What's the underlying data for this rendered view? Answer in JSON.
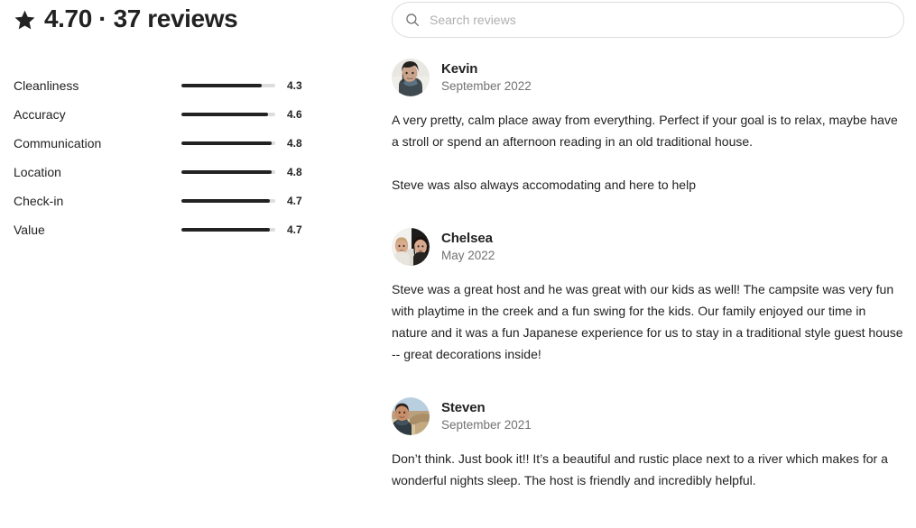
{
  "summary": {
    "star_icon": "star-icon",
    "headline": "4.70 · 37 reviews",
    "rating": "4.70",
    "review_count": "37 reviews"
  },
  "categories": [
    {
      "label": "Cleanliness",
      "value": "4.3",
      "fill_pct": 86
    },
    {
      "label": "Accuracy",
      "value": "4.6",
      "fill_pct": 92
    },
    {
      "label": "Communication",
      "value": "4.8",
      "fill_pct": 96
    },
    {
      "label": "Location",
      "value": "4.8",
      "fill_pct": 96
    },
    {
      "label": "Check-in",
      "value": "4.7",
      "fill_pct": 94
    },
    {
      "label": "Value",
      "value": "4.7",
      "fill_pct": 94
    }
  ],
  "search": {
    "icon": "search-icon",
    "placeholder": "Search reviews",
    "value": ""
  },
  "reviews": [
    {
      "avatar_alt": "avatar",
      "name": "Kevin",
      "date": "September 2022",
      "text": "A very pretty, calm place away from everything. Perfect if your goal is to relax, maybe have a stroll or spend an afternoon reading in an old traditional house.\n\nSteve was also always accomodating and here to help"
    },
    {
      "avatar_alt": "avatar",
      "name": "Chelsea",
      "date": "May 2022",
      "text": "Steve was a great host and he was great with our kids as well! The campsite was very fun with playtime in the creek and a fun swing for the kids. Our family enjoyed our time in nature and it was a fun Japanese experience for us to stay in a traditional style guest house -- great decorations inside!"
    },
    {
      "avatar_alt": "avatar",
      "name": "Steven",
      "date": "September 2021",
      "text": "Don’t think. Just book it!! It’s a beautiful and rustic place next to a river which makes for a wonderful nights sleep. The host is friendly and incredibly helpful."
    }
  ],
  "colors": {
    "text": "#222222",
    "muted": "#717171",
    "bar_fill": "#222222",
    "bar_track": "#dddddd",
    "border": "#dddddd",
    "placeholder": "#b0b0b0"
  }
}
